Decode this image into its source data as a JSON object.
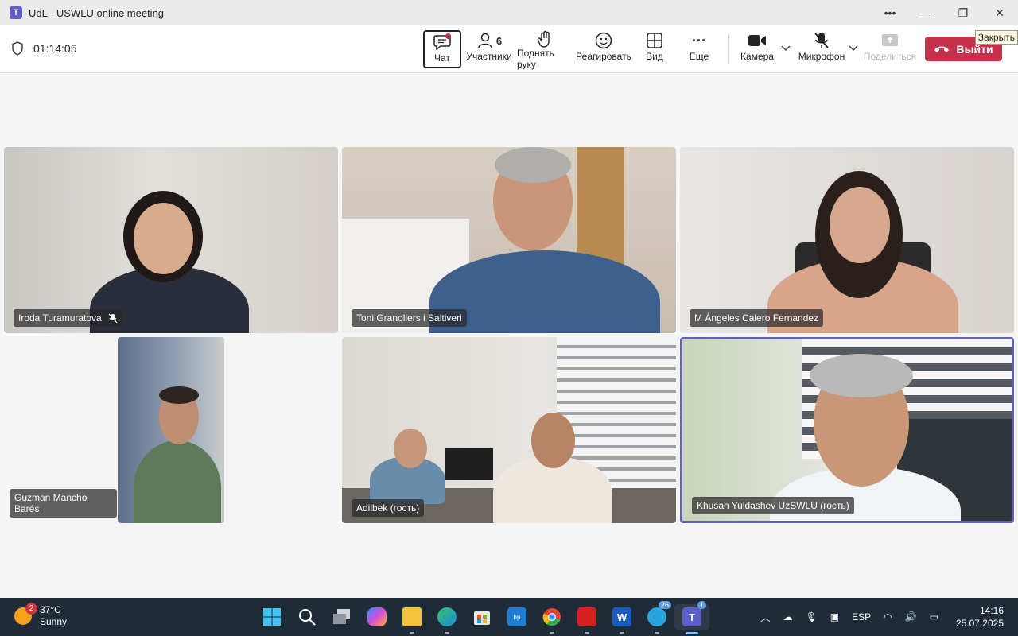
{
  "window": {
    "title": "UdL - USWLU online meeting",
    "tooltip": "Закрыть"
  },
  "meeting": {
    "timer": "01:14:05",
    "toolbar": {
      "chat_label": "Чат",
      "participants_label": "Участники",
      "participants_count": "6",
      "raise_hand_label": "Поднять руку",
      "react_label": "Реагировать",
      "view_label": "Вид",
      "more_label": "Еще",
      "camera_label": "Камера",
      "mic_label": "Микрофон",
      "share_label": "Поделиться",
      "leave_label": "Выйти"
    }
  },
  "participants": [
    {
      "name": "Iroda Turamuratova",
      "muted": true
    },
    {
      "name": "Toni Granollers i Saltiveri",
      "muted": false
    },
    {
      "name": "M Ángeles Calero Fernandez",
      "muted": false
    },
    {
      "name": "Guzman Mancho Barés",
      "muted": false
    },
    {
      "name": "Adilbek (гость)",
      "muted": false
    },
    {
      "name": "Khusan Yuldashev UzSWLU (гость)",
      "muted": false,
      "active_speaker": true
    }
  ],
  "taskbar": {
    "weather_temp": "37°C",
    "weather_desc": "Sunny",
    "weather_badge": "2",
    "telegram_badge": "26",
    "teams_badge": "1",
    "language": "ESP",
    "time": "14:16",
    "date": "25.07.2025"
  },
  "colors": {
    "accent": "#6264a7",
    "leave": "#c4314b",
    "taskbar": "#1f2b36"
  }
}
